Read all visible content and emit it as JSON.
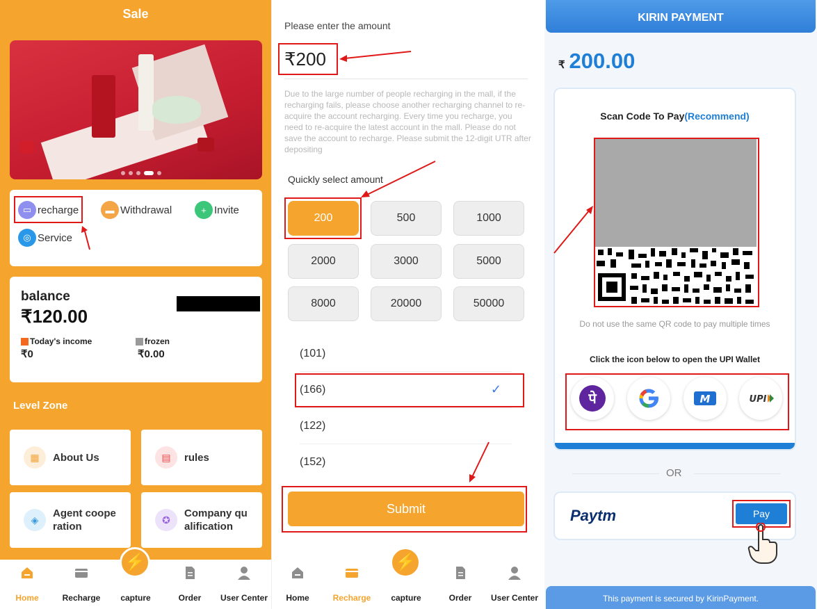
{
  "left": {
    "title": "Sale",
    "quick_actions": [
      "recharge",
      "Withdrawal",
      "Invite",
      "Service"
    ],
    "balance": {
      "label": "balance",
      "amount": "₹120.00",
      "today_income_label": "Today's income",
      "today_income_value": "₹0",
      "frozen_label": "frozen",
      "frozen_value": "₹0.00"
    },
    "level_zone": "Level Zone",
    "tiles": [
      "About Us",
      "rules",
      "Agent coope ration",
      "Company qu alification"
    ]
  },
  "middle": {
    "enter_label": "Please enter the amount",
    "currency": "₹",
    "amount": "200",
    "note": "Due to the large number of people recharging in the mall, if the recharging fails, please choose another recharging channel to re-acquire the account recharging. Every time you recharge, you need to re-acquire the latest account in the mall. Please do not save the account to recharge. Please submit the 12-digit UTR after depositing",
    "quick_label": "Quickly select amount",
    "amounts": [
      "200",
      "500",
      "1000",
      "2000",
      "3000",
      "5000",
      "8000",
      "20000",
      "50000"
    ],
    "selected_amount": "200",
    "channels": [
      "(101)",
      "(166)",
      "(122)",
      "(152)"
    ],
    "selected_channel": "(166)",
    "submit": "Submit"
  },
  "nav": {
    "left_items": [
      "Home",
      "Recharge",
      "capture",
      "Order",
      "User Center"
    ],
    "left_active": "Home",
    "middle_items": [
      "Home",
      "Recharge",
      "capture",
      "Order",
      "User Center"
    ],
    "middle_active": "Recharge"
  },
  "right": {
    "header": "KIRIN PAYMENT",
    "currency": "₹",
    "amount": "200.00",
    "scan_title": "Scan Code To Pay",
    "recommend": "(Recommend)",
    "qr_note": "Do not use the same QR code to pay multiple times",
    "upi_title": "Click the icon below to open the UPI Wallet",
    "wallets": [
      "phonepe-icon",
      "google-pay-icon",
      "mobikwik-icon",
      "upi-icon"
    ],
    "or": "OR",
    "paytm": "Paytm",
    "pay_button": "Pay",
    "footer": "This payment is secured by KirinPayment."
  },
  "colors": {
    "orange": "#f5a42e",
    "blue": "#1f7ed6",
    "annotation_red": "#e01818"
  }
}
